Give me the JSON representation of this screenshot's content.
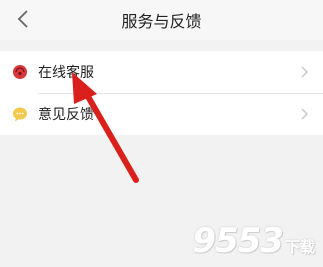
{
  "header": {
    "title": "服务与反馈"
  },
  "menu": [
    {
      "label": "在线客服",
      "icon": "online-service-icon",
      "icon_color": "#d9383a"
    },
    {
      "label": "意见反馈",
      "icon": "feedback-chat-icon",
      "icon_color": "#f2c94c"
    }
  ],
  "annotation": {
    "arrow_color": "#d9201b"
  },
  "watermark": {
    "number": "9553",
    "text": "下载"
  }
}
